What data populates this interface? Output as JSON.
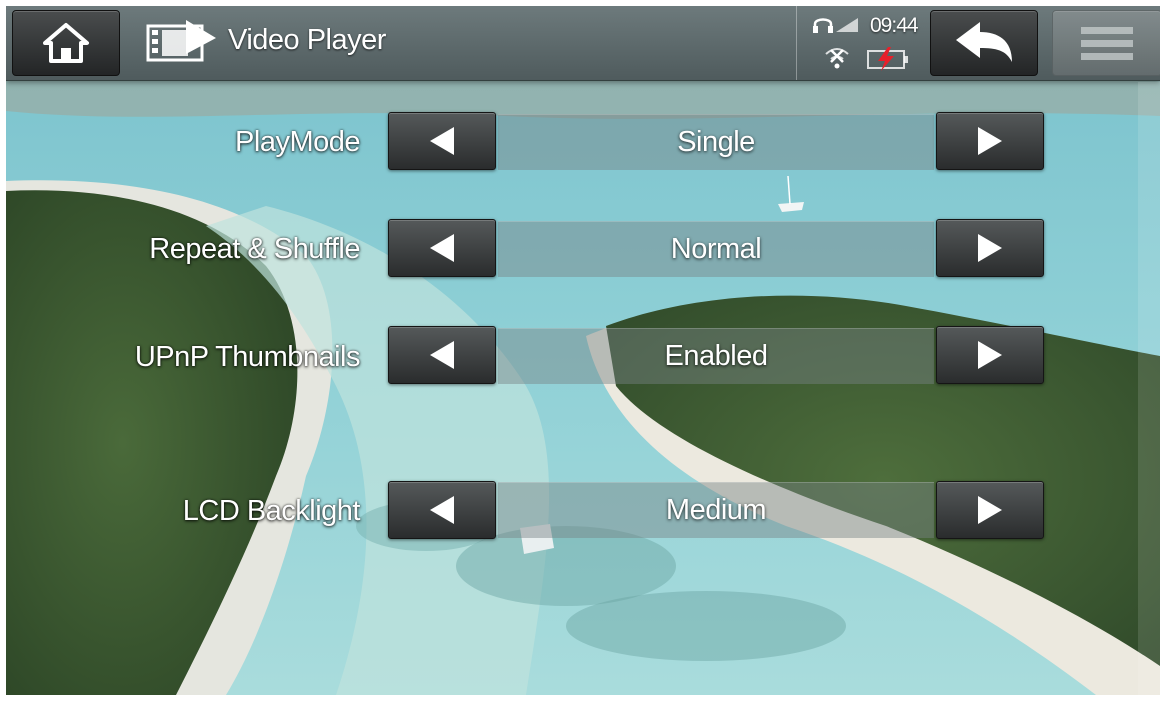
{
  "header": {
    "app_title": "Video Player",
    "clock": "09:44",
    "home_icon": "home-icon",
    "app_icon": "video-player-icon",
    "back_icon": "back-arrow-icon",
    "menu_icon": "menu-icon",
    "headphone_icon": "headphones-icon",
    "wifi_icon": "wifi-off-icon",
    "battery_icon": "battery-charging-icon"
  },
  "settings": [
    {
      "label": "PlayMode",
      "value": "Single"
    },
    {
      "label": "Repeat & Shuffle",
      "value": "Normal"
    },
    {
      "label": "UPnP Thumbnails",
      "value": "Enabled"
    },
    {
      "label": "LCD Backlight",
      "value": "Medium"
    }
  ],
  "colors": {
    "charging_bolt": "#e8202a",
    "lagoon": "#7fc3cf",
    "forest": "#3f5c33"
  }
}
